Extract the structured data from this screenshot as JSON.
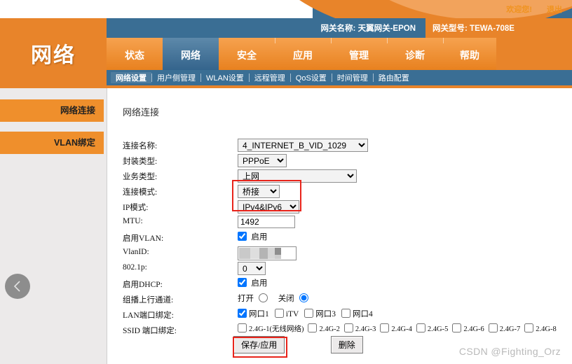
{
  "topbar": {
    "welcome": "欢迎您!",
    "logout": "退出"
  },
  "brand": {
    "title": "网络"
  },
  "gateway": {
    "name_label": "网关名称:",
    "name_value": "天翼网关-EPON",
    "model_label": "网关型号:",
    "model_value": "TEWA-708E"
  },
  "tabs": [
    {
      "label": "状态",
      "selected": false
    },
    {
      "label": "网络",
      "selected": true
    },
    {
      "label": "安全",
      "selected": false
    },
    {
      "label": "应用",
      "selected": false
    },
    {
      "label": "管理",
      "selected": false
    },
    {
      "label": "诊断",
      "selected": false
    },
    {
      "label": "帮助",
      "selected": false
    }
  ],
  "subnav": [
    {
      "label": "网络设置",
      "selected": true
    },
    {
      "label": "用户侧管理",
      "selected": false
    },
    {
      "label": "WLAN设置",
      "selected": false
    },
    {
      "label": "远程管理",
      "selected": false
    },
    {
      "label": "QoS设置",
      "selected": false
    },
    {
      "label": "时间管理",
      "selected": false
    },
    {
      "label": "路由配置",
      "selected": false
    }
  ],
  "sidebar": {
    "items": [
      {
        "label": "网络连接"
      },
      {
        "label": "VLAN绑定"
      }
    ],
    "collapse_icon": "chevron-left-icon"
  },
  "panel": {
    "title": "网络连接"
  },
  "form": {
    "conn_name": {
      "label": "连接名称:",
      "value": "4_INTERNET_B_VID_1029",
      "options": [
        "4_INTERNET_B_VID_1029"
      ]
    },
    "encap_type": {
      "label": "封装类型:",
      "value": "PPPoE",
      "options": [
        "PPPoE"
      ]
    },
    "service_type": {
      "label": "业务类型:",
      "value": "上网",
      "options": [
        "上网"
      ]
    },
    "conn_mode": {
      "label": "连接模式:",
      "value": "桥接",
      "options": [
        "桥接"
      ]
    },
    "ip_mode": {
      "label": "IP模式:",
      "value": "IPv4&IPv6",
      "options": [
        "IPv4&IPv6"
      ]
    },
    "mtu": {
      "label": "MTU:",
      "value": "1492"
    },
    "enable_vlan": {
      "label": "启用VLAN:",
      "checkbox_label": "启用",
      "checked": true
    },
    "vlan_id": {
      "label": "VlanID:",
      "value": "",
      "redacted": true
    },
    "dot1p": {
      "label": "802.1p:",
      "value": "0",
      "options": [
        "0"
      ]
    },
    "enable_dhcp": {
      "label": "启用DHCP:",
      "checkbox_label": "启用",
      "checked": true
    },
    "multicast": {
      "label": "组播上行通道:",
      "on_label": "打开",
      "off_label": "关闭",
      "selected": "关闭"
    },
    "lan_binding": {
      "label": "LAN端口绑定:",
      "ports": [
        {
          "label": "网口1",
          "checked": true
        },
        {
          "label": "iTV",
          "checked": false
        },
        {
          "label": "网口3",
          "checked": false
        },
        {
          "label": "网口4",
          "checked": false
        }
      ]
    },
    "ssid_binding": {
      "label": "SSID 端口绑定:",
      "ssids": [
        {
          "label": "2.4G-1(无线网络)",
          "checked": false
        },
        {
          "label": "2.4G-2",
          "checked": false
        },
        {
          "label": "2.4G-3",
          "checked": false
        },
        {
          "label": "2.4G-4",
          "checked": false
        },
        {
          "label": "2.4G-5",
          "checked": false
        },
        {
          "label": "2.4G-6",
          "checked": false
        },
        {
          "label": "2.4G-7",
          "checked": false
        },
        {
          "label": "2.4G-8",
          "checked": false
        }
      ]
    }
  },
  "actions": {
    "save": "保存/应用",
    "delete": "删除"
  },
  "watermark": "CSDN @Fighting_Orz",
  "colors": {
    "orange": "#e8842a",
    "orange_light": "#ef8f2c",
    "blue": "#3a6e94",
    "highlight_red": "#e8241b",
    "panel_bg": "#ffffff",
    "page_bg": "#eceaea"
  }
}
